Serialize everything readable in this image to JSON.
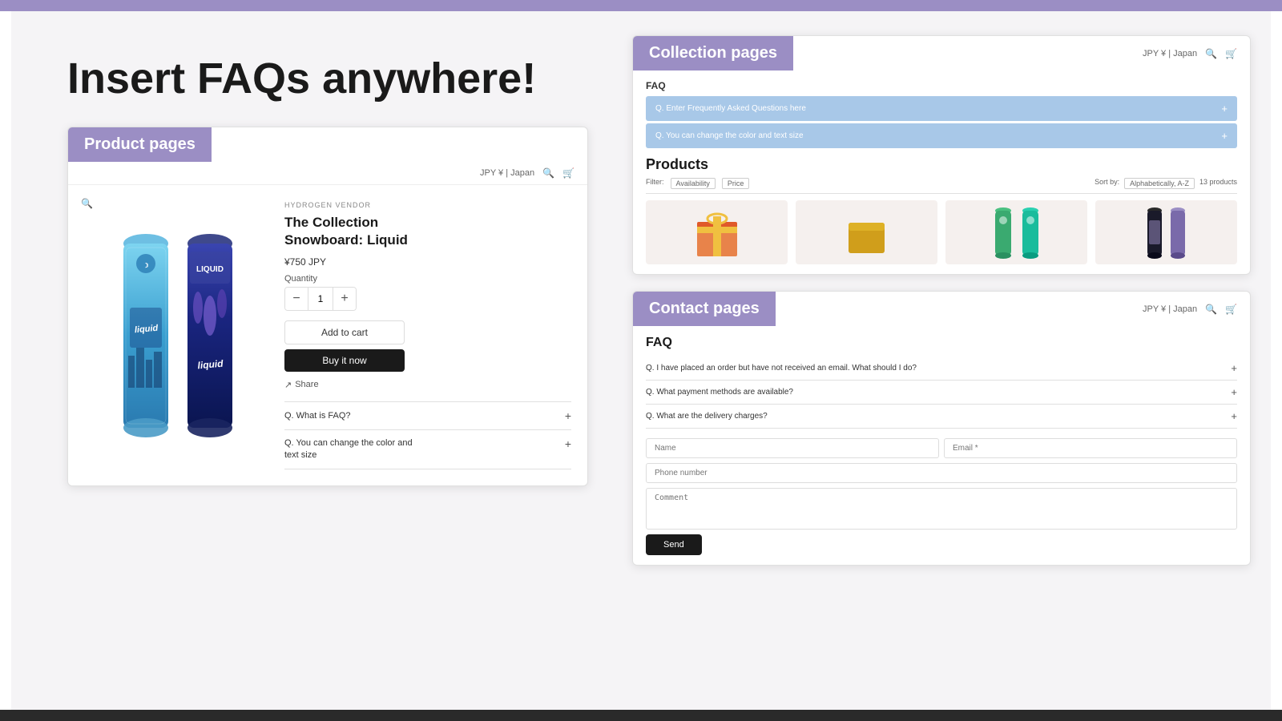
{
  "page": {
    "bg_purple": "#9b8ec4",
    "bg_dark": "#2a2a2a",
    "bg_light": "#f5f4f8"
  },
  "heading": {
    "main": "Insert FAQs anywhere!"
  },
  "product_page": {
    "label": "Product pages",
    "header": {
      "currency": "JPY ¥ | Japan",
      "search_icon": "🔍",
      "cart_icon": "🛒"
    },
    "zoom_icon": "🔍",
    "vendor": "HYDROGEN VENDOR",
    "title_line1": "The Collection",
    "title_line2": "Snowboard: Liquid",
    "price": "¥750 JPY",
    "quantity_label": "Quantity",
    "quantity_value": "1",
    "btn_add_cart": "Add to cart",
    "btn_buy_now": "Buy it now",
    "share_label": "Share",
    "faq_items": [
      {
        "question": "Q. What is FAQ?",
        "expanded": false
      },
      {
        "question": "Q. You can change the color and\ntext size",
        "expanded": false
      }
    ]
  },
  "collection_page": {
    "label": "Collection pages",
    "header": {
      "currency": "JPY ¥ | Japan"
    },
    "faq_title": "FAQ",
    "faq_blue_items": [
      {
        "text": "Q. Enter Frequently Asked Questions here"
      },
      {
        "text": "Q. You can change the color and text size"
      }
    ],
    "products_title": "Products",
    "filter_label": "Filter:",
    "availability_label": "Availability",
    "price_label": "Price",
    "sort_by_label": "Sort by:",
    "sort_value": "Alphabetically, A-Z",
    "count_label": "13 products"
  },
  "contact_page": {
    "label": "Contact pages",
    "header": {
      "currency": "JPY ¥ | Japan"
    },
    "faq_title": "FAQ",
    "faq_items": [
      {
        "text": "Q. I have placed an order but have not received an email. What should I do?"
      },
      {
        "text": "Q. What payment methods are available?"
      },
      {
        "text": "Q. What are the delivery charges?"
      }
    ],
    "form": {
      "name_placeholder": "Name",
      "email_placeholder": "Email *",
      "phone_placeholder": "Phone number",
      "comment_placeholder": "Comment",
      "btn_label": "Send"
    }
  }
}
